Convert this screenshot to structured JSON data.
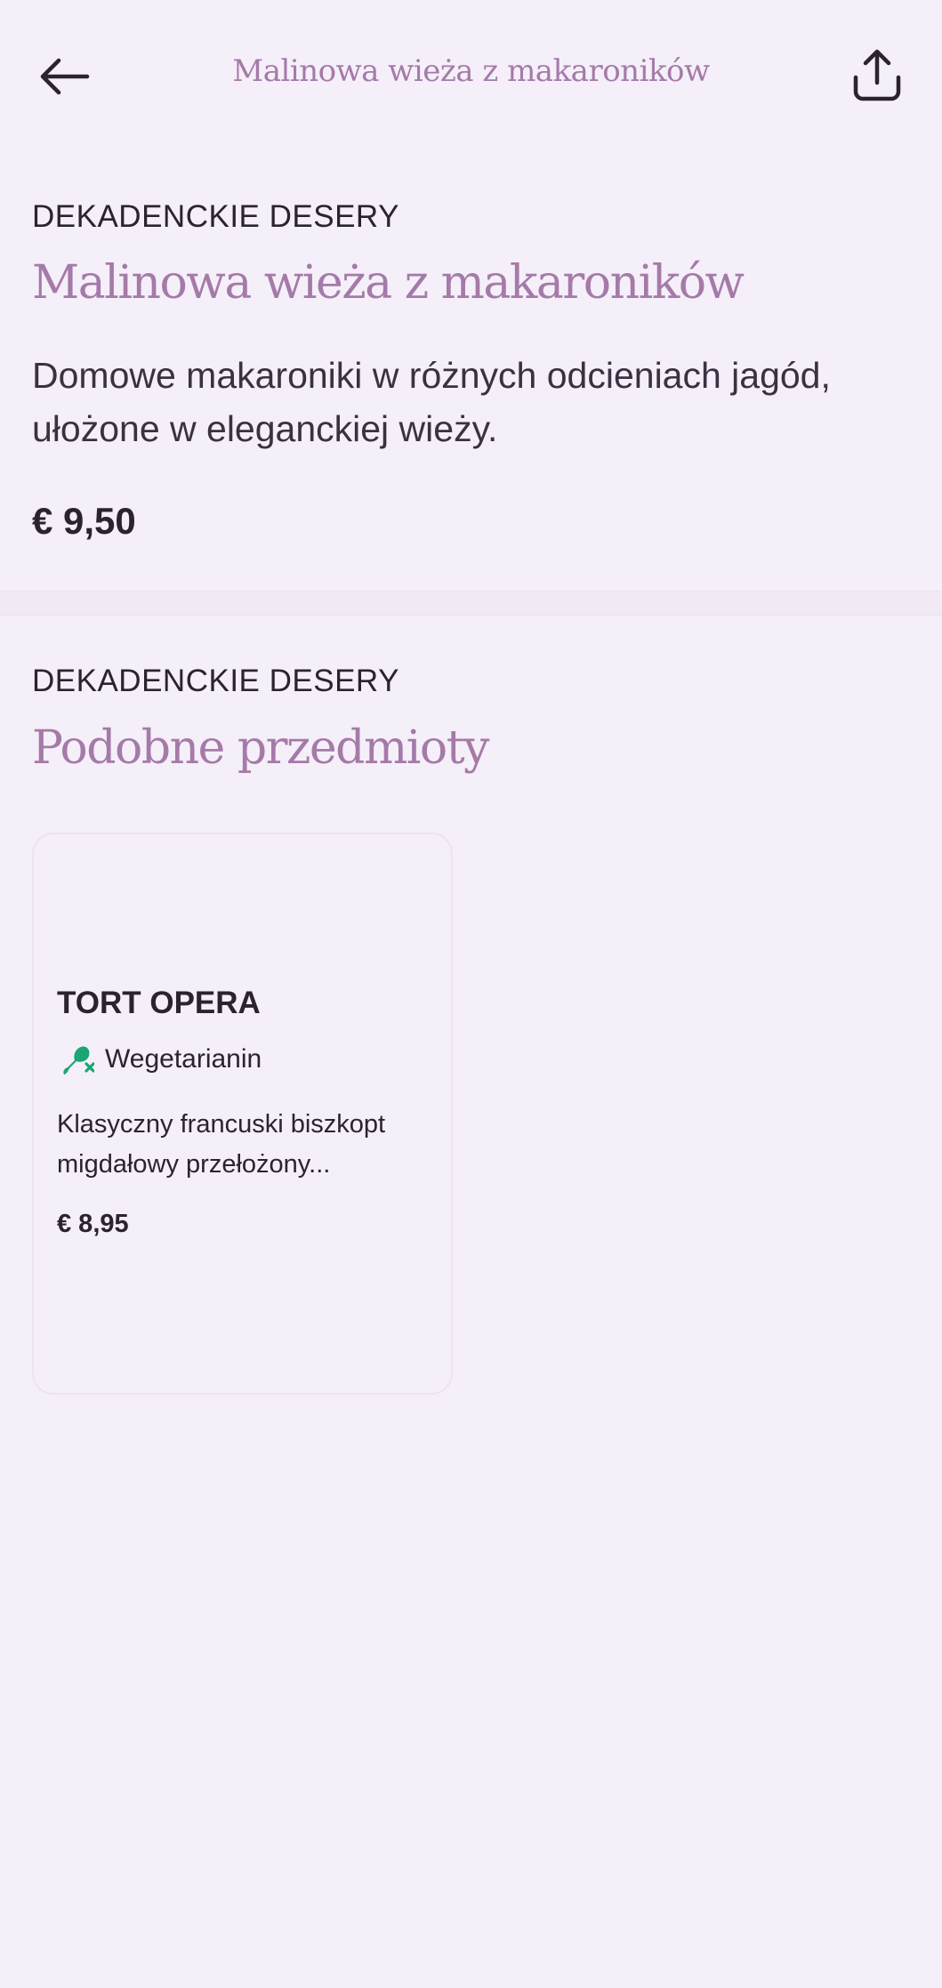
{
  "header": {
    "title": "Malinowa wieża z makaroników",
    "back_icon": "arrow-left-icon",
    "share_icon": "share-upload-icon"
  },
  "product": {
    "category": "DEKADENCKIE DESERY",
    "name": "Malinowa wieża z makaroników",
    "description": "Domowe makaroniki w różnych odcieniach jagód, ułożone w eleganckiej wieży.",
    "price": "€ 9,50"
  },
  "similar": {
    "category": "DEKADENCKIE DESERY",
    "heading": "Podobne przedmioty",
    "items": [
      {
        "name": "TORT OPERA",
        "diet_label": "Wegetarianin",
        "diet_icon": "vegetarian-no-meat-icon",
        "description": "Klasyczny francuski biszkopt migdałowy przełożony...",
        "price": "€ 8,95"
      }
    ]
  },
  "colors": {
    "background": "#f5eff9",
    "accent": "#a57aa8",
    "text": "#2b2430",
    "diet_icon": "#1aa673"
  }
}
